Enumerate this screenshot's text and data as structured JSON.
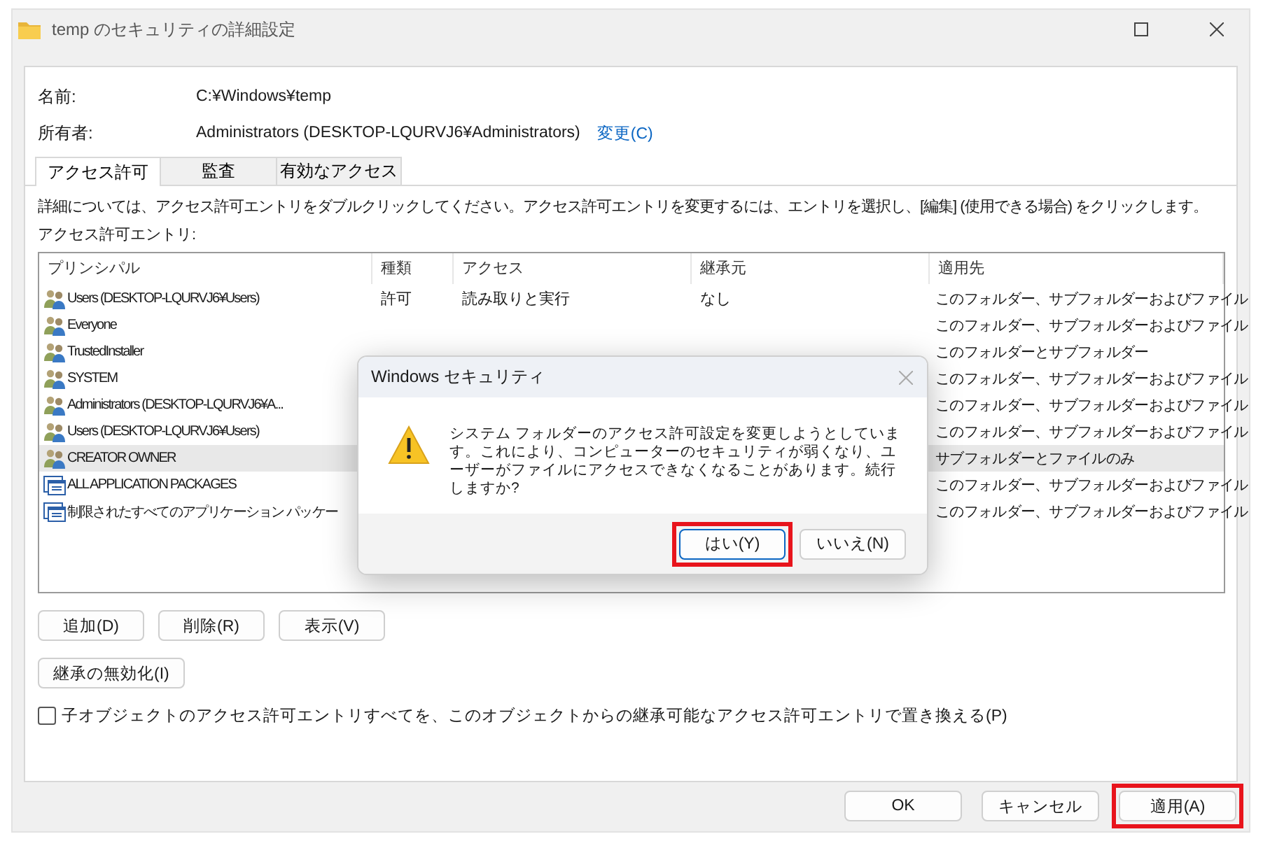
{
  "window": {
    "title": "temp のセキュリティの詳細設定"
  },
  "info": [
    {
      "label": "名前:",
      "value": "C:¥Windows¥temp"
    },
    {
      "label": "所有者:",
      "value": "Administrators (DESKTOP-LQURVJ6¥Administrators)",
      "link": "変更(C)"
    }
  ],
  "tabs": [
    {
      "label": "アクセス許可",
      "selected": true
    },
    {
      "label": "監査",
      "selected": false
    },
    {
      "label": "有効なアクセス",
      "selected": false
    }
  ],
  "instructions": "詳細については、アクセス許可エントリをダブルクリックしてください。アクセス許可エントリを変更するには、エントリを選択し、[編集] (使用できる場合) をクリックします。",
  "entries_label": "アクセス許可エントリ:",
  "table": {
    "columns": [
      "プリンシパル",
      "種類",
      "アクセス",
      "継承元",
      "適用先"
    ],
    "rows": [
      {
        "kind": "group",
        "selected": false,
        "cells": [
          "Users (DESKTOP-LQURVJ6¥Users)",
          "許可",
          "読み取りと実行",
          "なし",
          "このフォルダー、サブフォルダーおよびファイル"
        ]
      },
      {
        "kind": "group",
        "selected": false,
        "cells": [
          "Everyone",
          "",
          "",
          "",
          "このフォルダー、サブフォルダーおよびファイル"
        ]
      },
      {
        "kind": "group",
        "selected": false,
        "cells": [
          "TrustedInstaller",
          "",
          "",
          "",
          "このフォルダーとサブフォルダー"
        ]
      },
      {
        "kind": "group",
        "selected": false,
        "cells": [
          "SYSTEM",
          "",
          "",
          "",
          "このフォルダー、サブフォルダーおよびファイル"
        ]
      },
      {
        "kind": "group",
        "selected": false,
        "cells": [
          "Administrators (DESKTOP-LQURVJ6¥A...",
          "",
          "",
          "",
          "このフォルダー、サブフォルダーおよびファイル"
        ]
      },
      {
        "kind": "group",
        "selected": false,
        "cells": [
          "Users (DESKTOP-LQURVJ6¥Users)",
          "",
          "",
          "",
          "このフォルダー、サブフォルダーおよびファイル"
        ]
      },
      {
        "kind": "group",
        "selected": true,
        "cells": [
          "CREATOR OWNER",
          "",
          "",
          "",
          "サブフォルダーとファイルのみ"
        ]
      },
      {
        "kind": "package",
        "selected": false,
        "cells": [
          "ALL APPLICATION PACKAGES",
          "",
          "",
          "",
          "このフォルダー、サブフォルダーおよびファイル"
        ]
      },
      {
        "kind": "package",
        "selected": false,
        "cells": [
          "制限されたすべてのアプリケーション パッケー",
          "",
          "",
          "",
          "このフォルダー、サブフォルダーおよびファイル"
        ]
      }
    ]
  },
  "entry_buttons": [
    "追加(D)",
    "削除(R)",
    "表示(V)"
  ],
  "inheritance_button": "継承の無効化(I)",
  "replace_checkbox": {
    "label": "子オブジェクトのアクセス許可エントリすべてを、このオブジェクトからの継承可能なアクセス許可エントリで置き換える(P)",
    "checked": false
  },
  "footer_buttons": [
    {
      "label": "OK",
      "highlighted": false
    },
    {
      "label": "キャンセル",
      "highlighted": false
    },
    {
      "label": "適用(A)",
      "highlighted": true
    }
  ],
  "dialog": {
    "title": "Windows セキュリティ",
    "message": "システム フォルダーのアクセス許可設定を変更しようとしています。これにより、コンピューターのセキュリティが弱くなり、ユーザーがファイルにアクセスできなくなることがあります。続行しますか?",
    "buttons": [
      {
        "label": "はい(Y)",
        "default": true,
        "highlighted": true
      },
      {
        "label": "いいえ(N)",
        "default": false,
        "highlighted": false
      }
    ]
  }
}
